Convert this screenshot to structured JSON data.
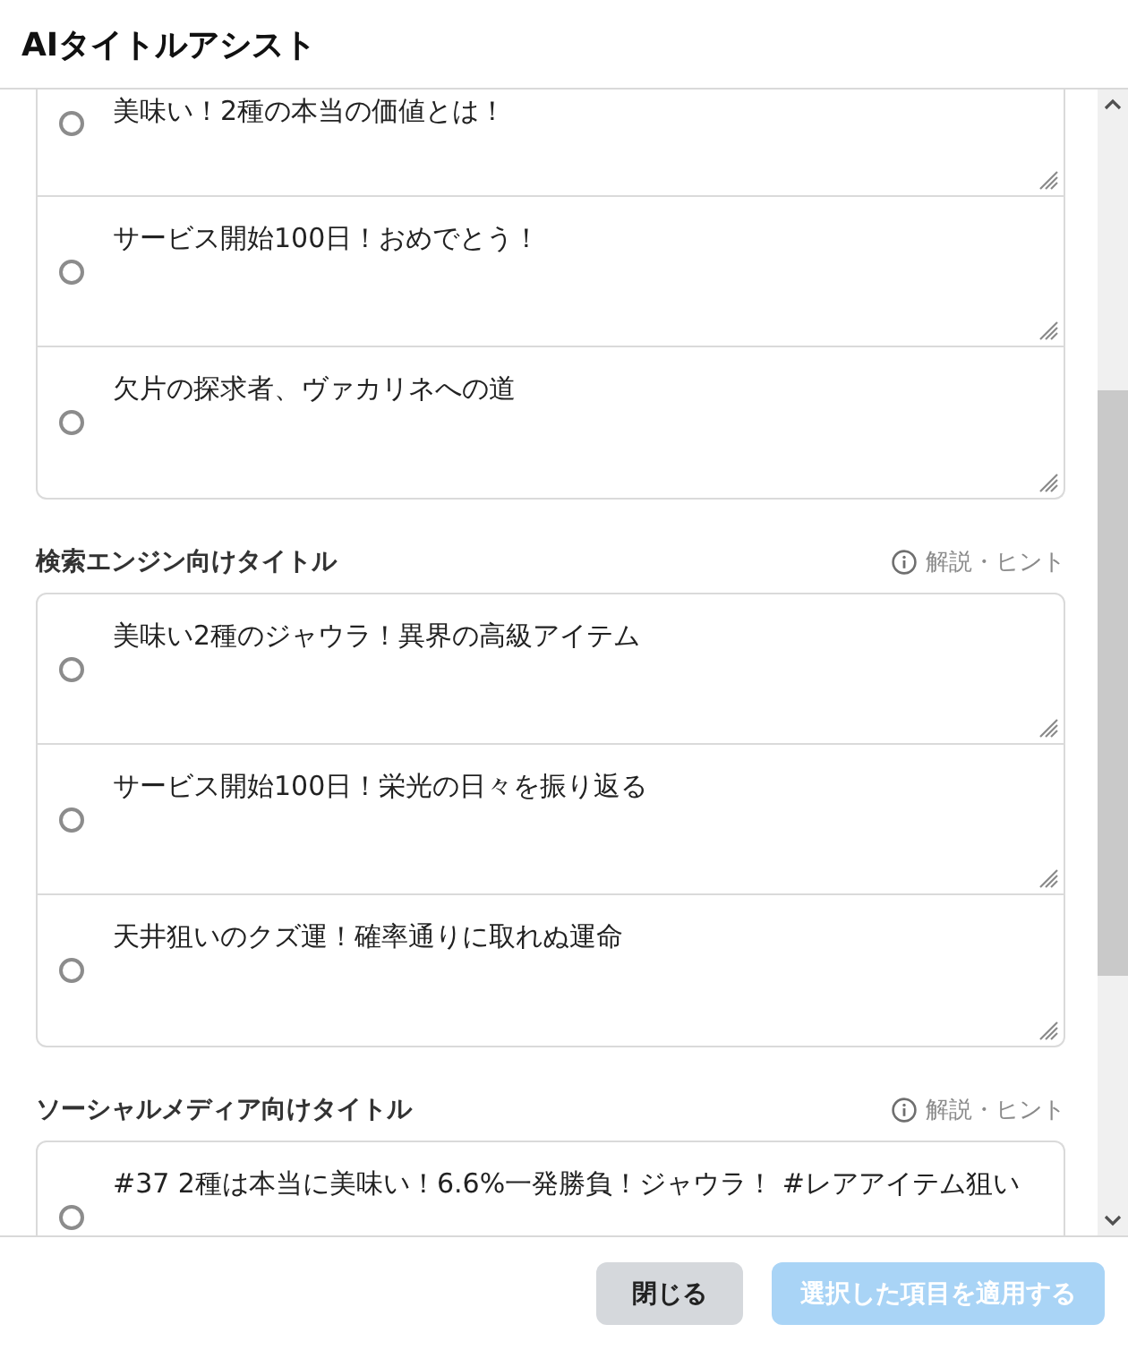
{
  "dialog": {
    "title": "AIタイトルアシスト"
  },
  "sections": [
    {
      "options": [
        {
          "text": "美味い！2種の本当の価値とは！",
          "selected": false
        },
        {
          "text": "サービス開始100日！おめでとう！",
          "selected": false
        },
        {
          "text": "欠片の探求者、ヴァカリネへの道",
          "selected": false
        }
      ]
    },
    {
      "title": "検索エンジン向けタイトル",
      "hint": "解説・ヒント",
      "options": [
        {
          "text": "美味い2種のジャウラ！異界の高級アイテム",
          "selected": false
        },
        {
          "text": "サービス開始100日！栄光の日々を振り返る",
          "selected": false
        },
        {
          "text": "天井狙いのクズ運！確率通りに取れぬ運命",
          "selected": false
        }
      ]
    },
    {
      "title": "ソーシャルメディア向けタイトル",
      "hint": "解説・ヒント",
      "options": [
        {
          "text": "#37 2種は本当に美味い！6.6%一発勝負！ジャウラ！ #レアアイテム狙い",
          "selected": false
        }
      ]
    }
  ],
  "footer": {
    "buttons": [
      {
        "label": "閉じる",
        "kind": "secondary",
        "disabled": false
      },
      {
        "label": "選択した項目を適用する",
        "kind": "primary",
        "disabled": true
      }
    ]
  }
}
